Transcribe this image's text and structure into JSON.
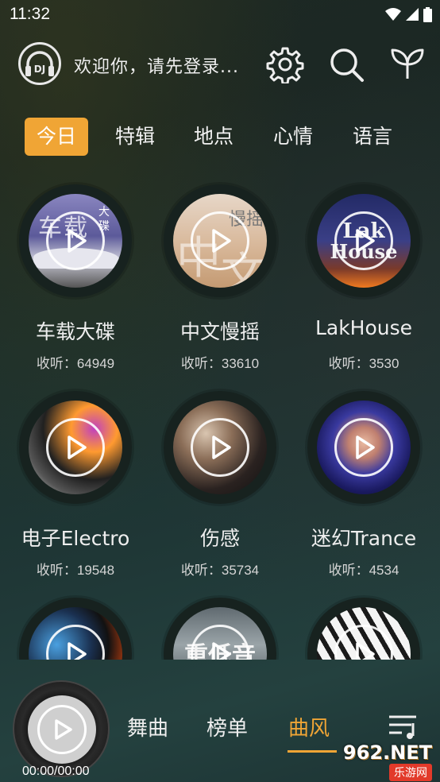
{
  "status_bar": {
    "time": "11:32",
    "icons": [
      "wifi-icon",
      "signal-icon",
      "battery-icon"
    ]
  },
  "header": {
    "avatar_label": "DJ",
    "welcome": "欢迎你，请先登录...",
    "icons": [
      "settings-gear-icon",
      "search-icon",
      "sprout-icon"
    ]
  },
  "tabs": [
    {
      "label": "今日",
      "active": true
    },
    {
      "label": "特辑",
      "active": false
    },
    {
      "label": "地点",
      "active": false
    },
    {
      "label": "心情",
      "active": false
    },
    {
      "label": "语言",
      "active": false
    }
  ],
  "cards": [
    {
      "title": "车载大碟",
      "listens": "收听：64949"
    },
    {
      "title": "中文慢摇",
      "listens": "收听：33610"
    },
    {
      "title": "LakHouse",
      "listens": "收听：3530"
    },
    {
      "title": "电子Electro",
      "listens": "收听：19548"
    },
    {
      "title": "伤感",
      "listens": "收听：35734"
    },
    {
      "title": "迷幻Trance",
      "listens": "收听：4534"
    },
    {
      "title": "",
      "listens": ""
    },
    {
      "title": "",
      "listens": ""
    },
    {
      "title": "",
      "listens": ""
    }
  ],
  "artwork_text": {
    "card1_lines": [
      "车载",
      "大",
      "碟"
    ],
    "card2_lines": [
      "慢",
      "摇",
      "中",
      "文"
    ],
    "card3_lines": [
      "Lak",
      "House"
    ],
    "card8_text": "重低音"
  },
  "bottom": {
    "time": "00:00/00:00",
    "tabs": [
      {
        "label": "舞曲",
        "active": false
      },
      {
        "label": "榜单",
        "active": false
      },
      {
        "label": "曲风",
        "active": true
      }
    ],
    "menu_icon": "playlist-icon"
  },
  "watermark": {
    "main": "962.NET",
    "sub": "乐游网"
  },
  "colors": {
    "accent": "#f0a535",
    "text": "#eeeeee"
  }
}
